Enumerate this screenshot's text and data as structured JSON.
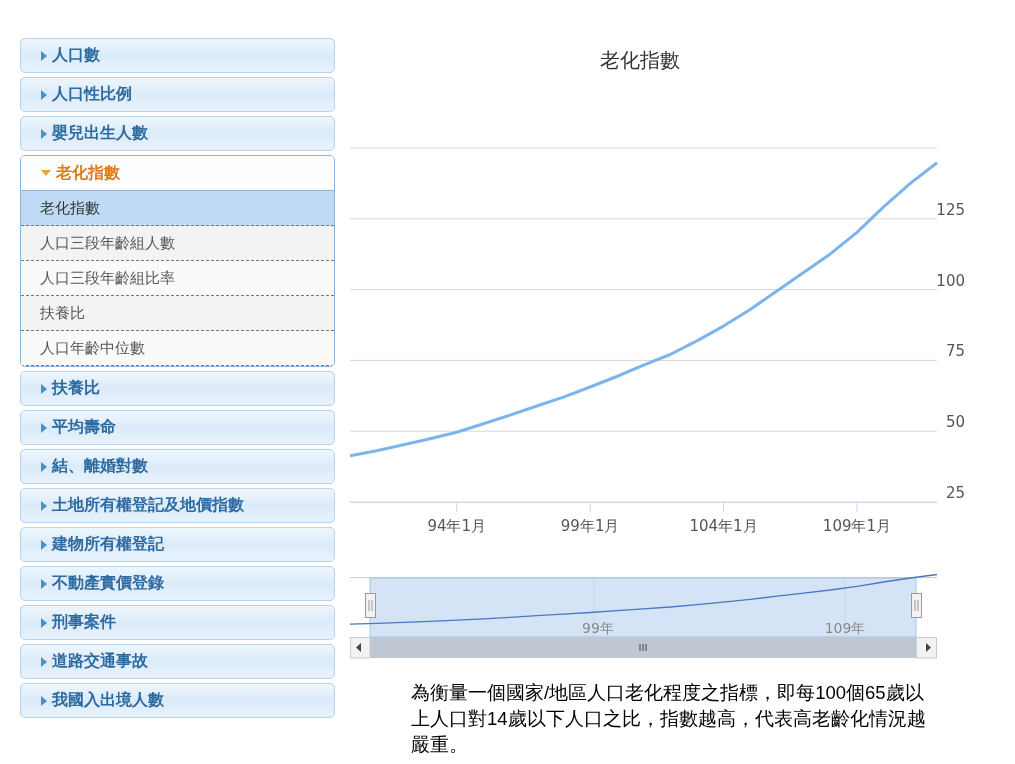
{
  "menu": [
    {
      "label": "人口數",
      "expanded": false
    },
    {
      "label": "人口性比例",
      "expanded": false
    },
    {
      "label": "嬰兒出生人數",
      "expanded": false
    },
    {
      "label": "老化指數",
      "expanded": true,
      "children": [
        {
          "label": "老化指數",
          "selected": true
        },
        {
          "label": "人口三段年齡組人數",
          "selected": false
        },
        {
          "label": "人口三段年齡組比率",
          "selected": false
        },
        {
          "label": "扶養比",
          "selected": false
        },
        {
          "label": "人口年齡中位數",
          "selected": false
        }
      ]
    },
    {
      "label": "扶養比",
      "expanded": false
    },
    {
      "label": "平均壽命",
      "expanded": false
    },
    {
      "label": "結、離婚對數",
      "expanded": false
    },
    {
      "label": "土地所有權登記及地價指數",
      "expanded": false
    },
    {
      "label": "建物所有權登記",
      "expanded": false
    },
    {
      "label": "不動產實價登錄",
      "expanded": false
    },
    {
      "label": "刑事案件",
      "expanded": false
    },
    {
      "label": "道路交通事故",
      "expanded": false
    },
    {
      "label": "我國入出境人數",
      "expanded": false
    }
  ],
  "chart": {
    "chart_data": {
      "type": "line",
      "title": "老化指數",
      "categories": [
        null,
        null,
        null,
        null,
        "94年1月",
        null,
        null,
        null,
        null,
        "99年1月",
        null,
        null,
        null,
        null,
        "104年1月",
        null,
        null,
        null,
        null,
        "109年1月",
        null,
        null,
        null
      ],
      "series": [
        {
          "color": "#7cb5ec",
          "values": [
            41.3,
            43.1,
            45.2,
            47.3,
            49.6,
            52.6,
            55.7,
            58.9,
            62.0,
            65.6,
            69.3,
            73.3,
            77.1,
            81.9,
            87.1,
            93.0,
            99.5,
            106.0,
            112.6,
            120.2,
            129.2,
            137.5,
            144.8
          ]
        }
      ],
      "ylim": [
        25,
        150
      ],
      "grid": true,
      "yticks": [
        25,
        50,
        75,
        100,
        125
      ]
    }
  },
  "navigator": {
    "labels": [
      "99年",
      "109年"
    ]
  },
  "description": "為衡量一個國家/地區人口老化程度之指標，即每100個65歲以上人口對14歲以下人口之比，指數越高，代表高老齡化情況越嚴重。"
}
